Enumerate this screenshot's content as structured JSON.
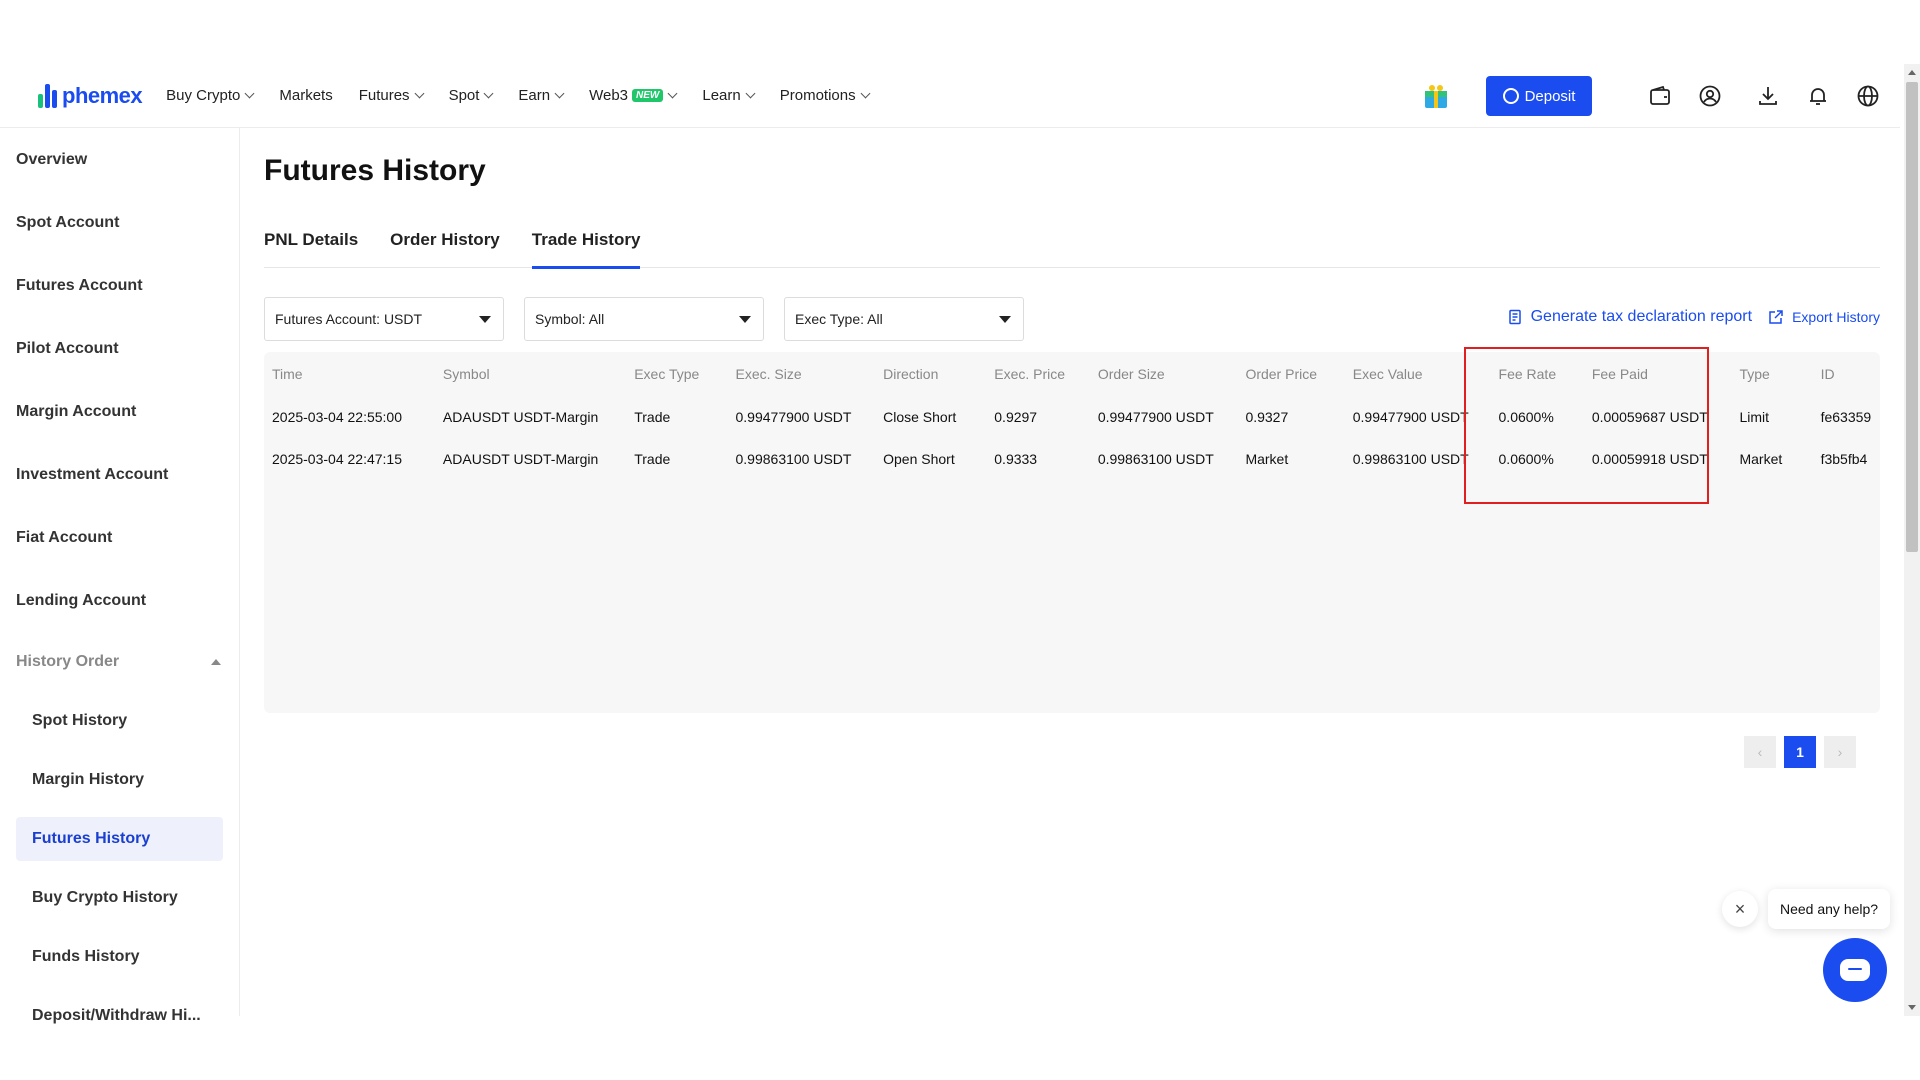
{
  "brand": {
    "name": "phemex",
    "color": "#1a4cf0"
  },
  "nav": [
    {
      "label": "Buy Crypto",
      "dropdown": true
    },
    {
      "label": "Markets",
      "dropdown": false
    },
    {
      "label": "Futures",
      "dropdown": true
    },
    {
      "label": "Spot",
      "dropdown": true
    },
    {
      "label": "Earn",
      "dropdown": true
    },
    {
      "label": "Web3",
      "dropdown": true,
      "badge": "NEW"
    },
    {
      "label": "Learn",
      "dropdown": true
    },
    {
      "label": "Promotions",
      "dropdown": true
    }
  ],
  "header_actions": {
    "deposit_label": "Deposit",
    "icons": [
      "gift-icon",
      "wallet-icon",
      "user-icon",
      "download-icon",
      "bell-icon",
      "globe-icon"
    ]
  },
  "sidebar": {
    "items": [
      "Overview",
      "Spot Account",
      "Futures Account",
      "Pilot Account",
      "Margin Account",
      "Investment Account",
      "Fiat Account",
      "Lending Account"
    ],
    "group": "History Order",
    "sub_items": [
      "Spot History",
      "Margin History",
      "Futures History",
      "Buy Crypto History",
      "Funds History",
      "Deposit/Withdraw Hi..."
    ],
    "active_sub": "Futures History"
  },
  "page": {
    "title": "Futures History"
  },
  "tabs": [
    {
      "label": "PNL Details",
      "active": false
    },
    {
      "label": "Order History",
      "active": false
    },
    {
      "label": "Trade History",
      "active": true
    }
  ],
  "filters": {
    "account": "Futures Account: USDT",
    "symbol": "Symbol: All",
    "exec_type": "Exec Type: All"
  },
  "actions": {
    "tax_report": "Generate tax declaration report",
    "export": "Export History"
  },
  "table": {
    "columns": [
      "Time",
      "Symbol",
      "Exec Type",
      "Exec. Size",
      "Direction",
      "Exec. Price",
      "Order Size",
      "Order Price",
      "Exec Value",
      "Fee Rate",
      "Fee Paid",
      "Type",
      "ID"
    ],
    "rows": [
      [
        "2025-03-04 22:55:00",
        "ADAUSDT USDT-Margin",
        "Trade",
        "0.99477900 USDT",
        "Close Short",
        "0.9297",
        "0.99477900 USDT",
        "0.9327",
        "0.99477900 USDT",
        "0.0600%",
        "0.00059687 USDT",
        "Limit",
        "fe63359"
      ],
      [
        "2025-03-04 22:47:15",
        "ADAUSDT USDT-Margin",
        "Trade",
        "0.99863100 USDT",
        "Open Short",
        "0.9333",
        "0.99863100 USDT",
        "Market",
        "0.99863100 USDT",
        "0.0600%",
        "0.00059918 USDT",
        "Market",
        "f3b5fb4"
      ]
    ]
  },
  "pagination": {
    "prev": "‹",
    "current": "1",
    "next": "›"
  },
  "help": {
    "bubble": "Need any help?",
    "close": "×"
  }
}
